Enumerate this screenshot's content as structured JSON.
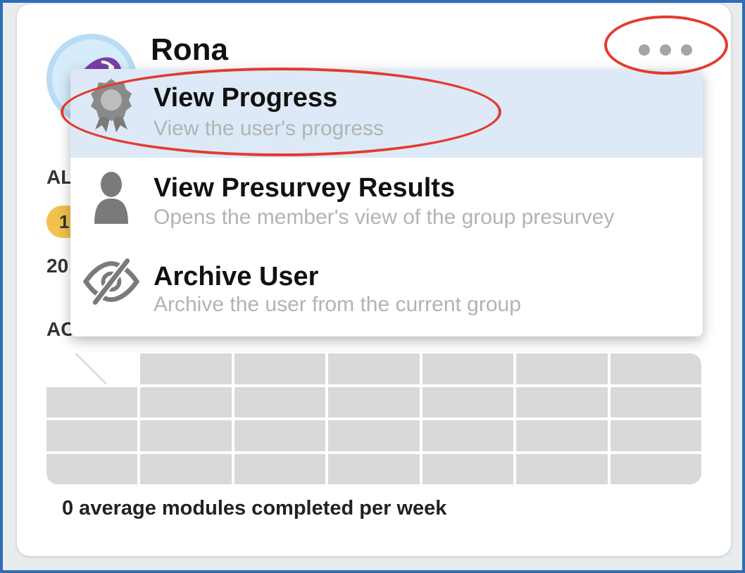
{
  "user": {
    "name": "Rona"
  },
  "background": {
    "section_label_1": "AL",
    "badge_value": "1",
    "date_fragment": "20",
    "section_label_2": "AC",
    "summary": "0 average modules completed per week"
  },
  "menu": {
    "items": [
      {
        "title": "View Progress",
        "description": "View the user's progress",
        "icon": "award-ribbon-icon"
      },
      {
        "title": "View Presurvey Results",
        "description": "Opens the member's view of the group presurvey",
        "icon": "person-icon"
      },
      {
        "title": "Archive User",
        "description": "Archive the user from the current group",
        "icon": "eye-slash-icon"
      }
    ]
  },
  "colors": {
    "frame_border": "#2f6db5",
    "annotation": "#e33b2e",
    "menu_active": "#dde9f7",
    "icon_gray": "#7a7a7a",
    "badge": "#f2c14e"
  }
}
